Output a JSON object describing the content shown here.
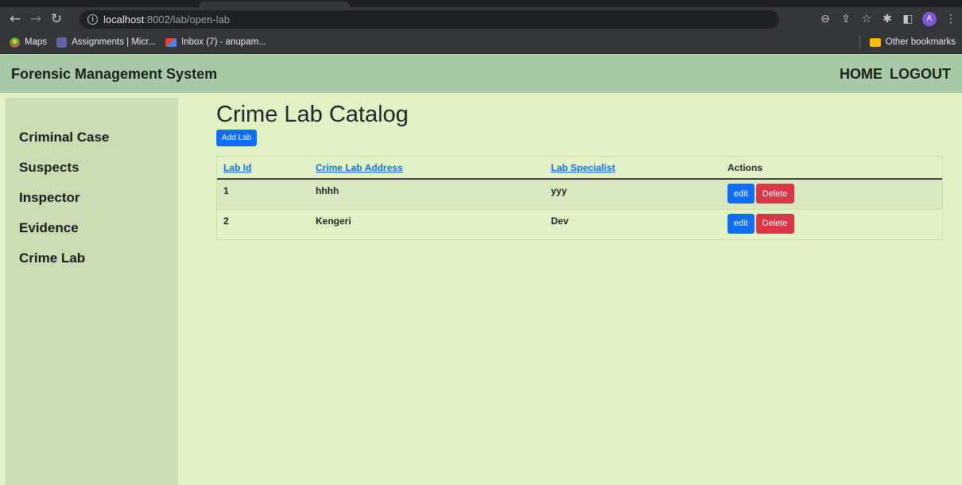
{
  "browser": {
    "url_host": "localhost",
    "url_path": ":8002/lab/open-lab",
    "profile_initial": "A",
    "bookmarks": [
      {
        "label": "Maps"
      },
      {
        "label": "Assignments | Micr..."
      },
      {
        "label": "Inbox (7) - anupam..."
      }
    ],
    "other_bookmarks": "Other bookmarks"
  },
  "header": {
    "brand": "Forensic Management System",
    "links": [
      "HOME",
      "LOGOUT"
    ]
  },
  "sidebar": {
    "items": [
      {
        "label": "Criminal Case"
      },
      {
        "label": "Suspects"
      },
      {
        "label": "Inspector"
      },
      {
        "label": "Evidence"
      },
      {
        "label": "Crime Lab"
      }
    ]
  },
  "main": {
    "title": "Crime Lab Catalog",
    "add_button": "Add Lab",
    "columns": [
      "Lab Id",
      "Crime Lab Address",
      "Lab Specialist",
      "Actions"
    ],
    "rows": [
      {
        "id": "1",
        "address": "hhhh",
        "specialist": "yyy"
      },
      {
        "id": "2",
        "address": "Kengeri",
        "specialist": "Dev"
      }
    ],
    "edit_label": "edit",
    "delete_label": "Delete"
  },
  "colors": {
    "page_bg": "#e2f1c4",
    "header_bg": "#a8c8a8",
    "sidebar_bg": "#c9dcb2",
    "primary": "#0d6efd",
    "danger": "#dc3545"
  }
}
